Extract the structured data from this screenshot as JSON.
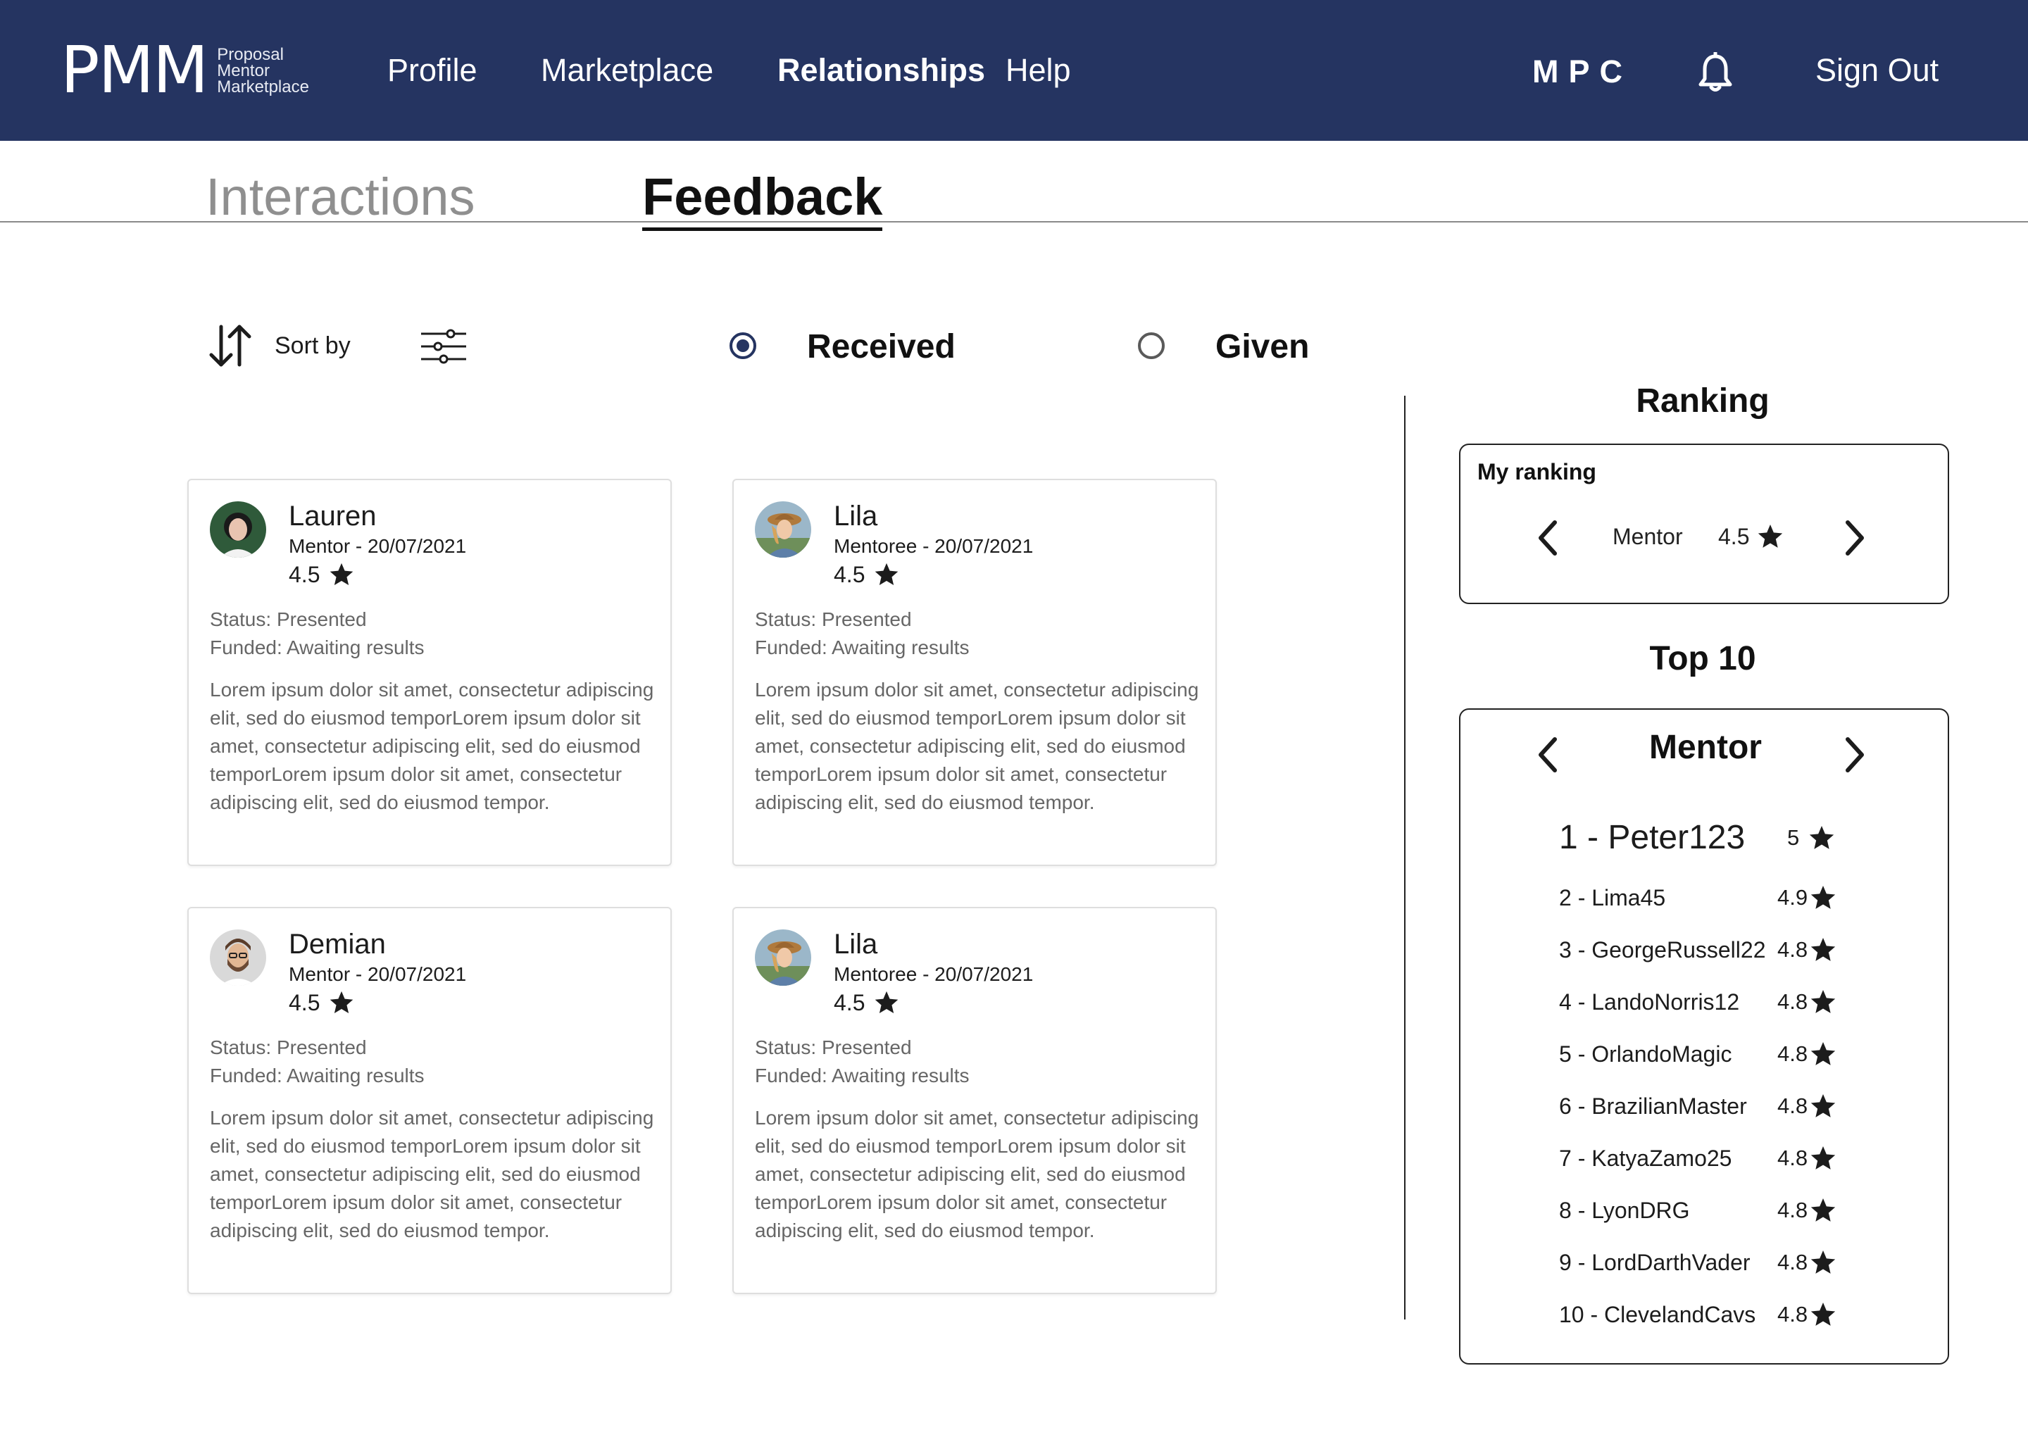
{
  "header": {
    "logo": {
      "mark": "PMM",
      "line1": "Proposal",
      "line2": "Mentor",
      "line3": "Marketplace"
    },
    "nav": {
      "profile": "Profile",
      "marketplace": "Marketplace",
      "relationships": "Relationships",
      "help": "Help"
    },
    "initials": "MPC",
    "bell_icon": "bell-icon",
    "signout": "Sign Out",
    "colors": {
      "bar": "#253461",
      "text": "#ffffff"
    }
  },
  "tabs": {
    "interactions": "Interactions",
    "feedback": "Feedback",
    "active": "Feedback"
  },
  "toolbar": {
    "sort_label": "Sort by",
    "sort_icon": "sort-arrows-icon",
    "filter_icon": "sliders-icon",
    "received": "Received",
    "given": "Given",
    "selected": "Received"
  },
  "cards": [
    {
      "name": "Lauren",
      "role_date": "Mentor - 20/07/2021",
      "rating": "4.5",
      "status": "Status: Presented",
      "funded": "Funded: Awaiting results",
      "description": "Lorem ipsum dolor sit amet, consectetur adipiscing elit, sed do eiusmod temporLorem ipsum dolor sit amet, consectetur adipiscing elit, sed do eiusmod temporLorem ipsum dolor sit amet, consectetur adipiscing elit, sed do eiusmod tempor."
    },
    {
      "name": "Lila",
      "role_date": "Mentoree - 20/07/2021",
      "rating": "4.5",
      "status": "Status: Presented",
      "funded": "Funded: Awaiting results",
      "description": "Lorem ipsum dolor sit amet, consectetur adipiscing elit, sed do eiusmod temporLorem ipsum dolor sit amet, consectetur adipiscing elit, sed do eiusmod temporLorem ipsum dolor sit amet, consectetur adipiscing elit, sed do eiusmod tempor."
    },
    {
      "name": "Demian",
      "role_date": "Mentor - 20/07/2021",
      "rating": "4.5",
      "status": "Status: Presented",
      "funded": "Funded: Awaiting results",
      "description": "Lorem ipsum dolor sit amet, consectetur adipiscing elit, sed do eiusmod temporLorem ipsum dolor sit amet, consectetur adipiscing elit, sed do eiusmod temporLorem ipsum dolor sit amet, consectetur adipiscing elit, sed do eiusmod tempor."
    },
    {
      "name": "Lila",
      "role_date": "Mentoree - 20/07/2021",
      "rating": "4.5",
      "status": "Status: Presented",
      "funded": "Funded: Awaiting results",
      "description": "Lorem ipsum dolor sit amet, consectetur adipiscing elit, sed do eiusmod temporLorem ipsum dolor sit amet, consectetur adipiscing elit, sed do eiusmod temporLorem ipsum dolor sit amet, consectetur adipiscing elit, sed do eiusmod tempor."
    }
  ],
  "ranking": {
    "title": "Ranking",
    "my_ranking": {
      "label": "My ranking",
      "role": "Mentor",
      "score": "4.5"
    },
    "top10": {
      "title": "Top 10",
      "category": "Mentor",
      "entries": [
        {
          "name": "1 -  Peter123",
          "score": "5"
        },
        {
          "name": "2 - Lima45",
          "score": "4.9"
        },
        {
          "name": "3 - GeorgeRussell22",
          "score": "4.8"
        },
        {
          "name": "4 - LandoNorris12",
          "score": "4.8"
        },
        {
          "name": "5 - OrlandoMagic",
          "score": "4.8"
        },
        {
          "name": "6 - BrazilianMaster",
          "score": "4.8"
        },
        {
          "name": "7 - KatyaZamo25",
          "score": "4.8"
        },
        {
          "name": "8 - LyonDRG",
          "score": "4.8"
        },
        {
          "name": "9 - LordDarthVader",
          "score": "4.8"
        },
        {
          "name": "10 - ClevelandCavs",
          "score": "4.8"
        }
      ]
    }
  }
}
